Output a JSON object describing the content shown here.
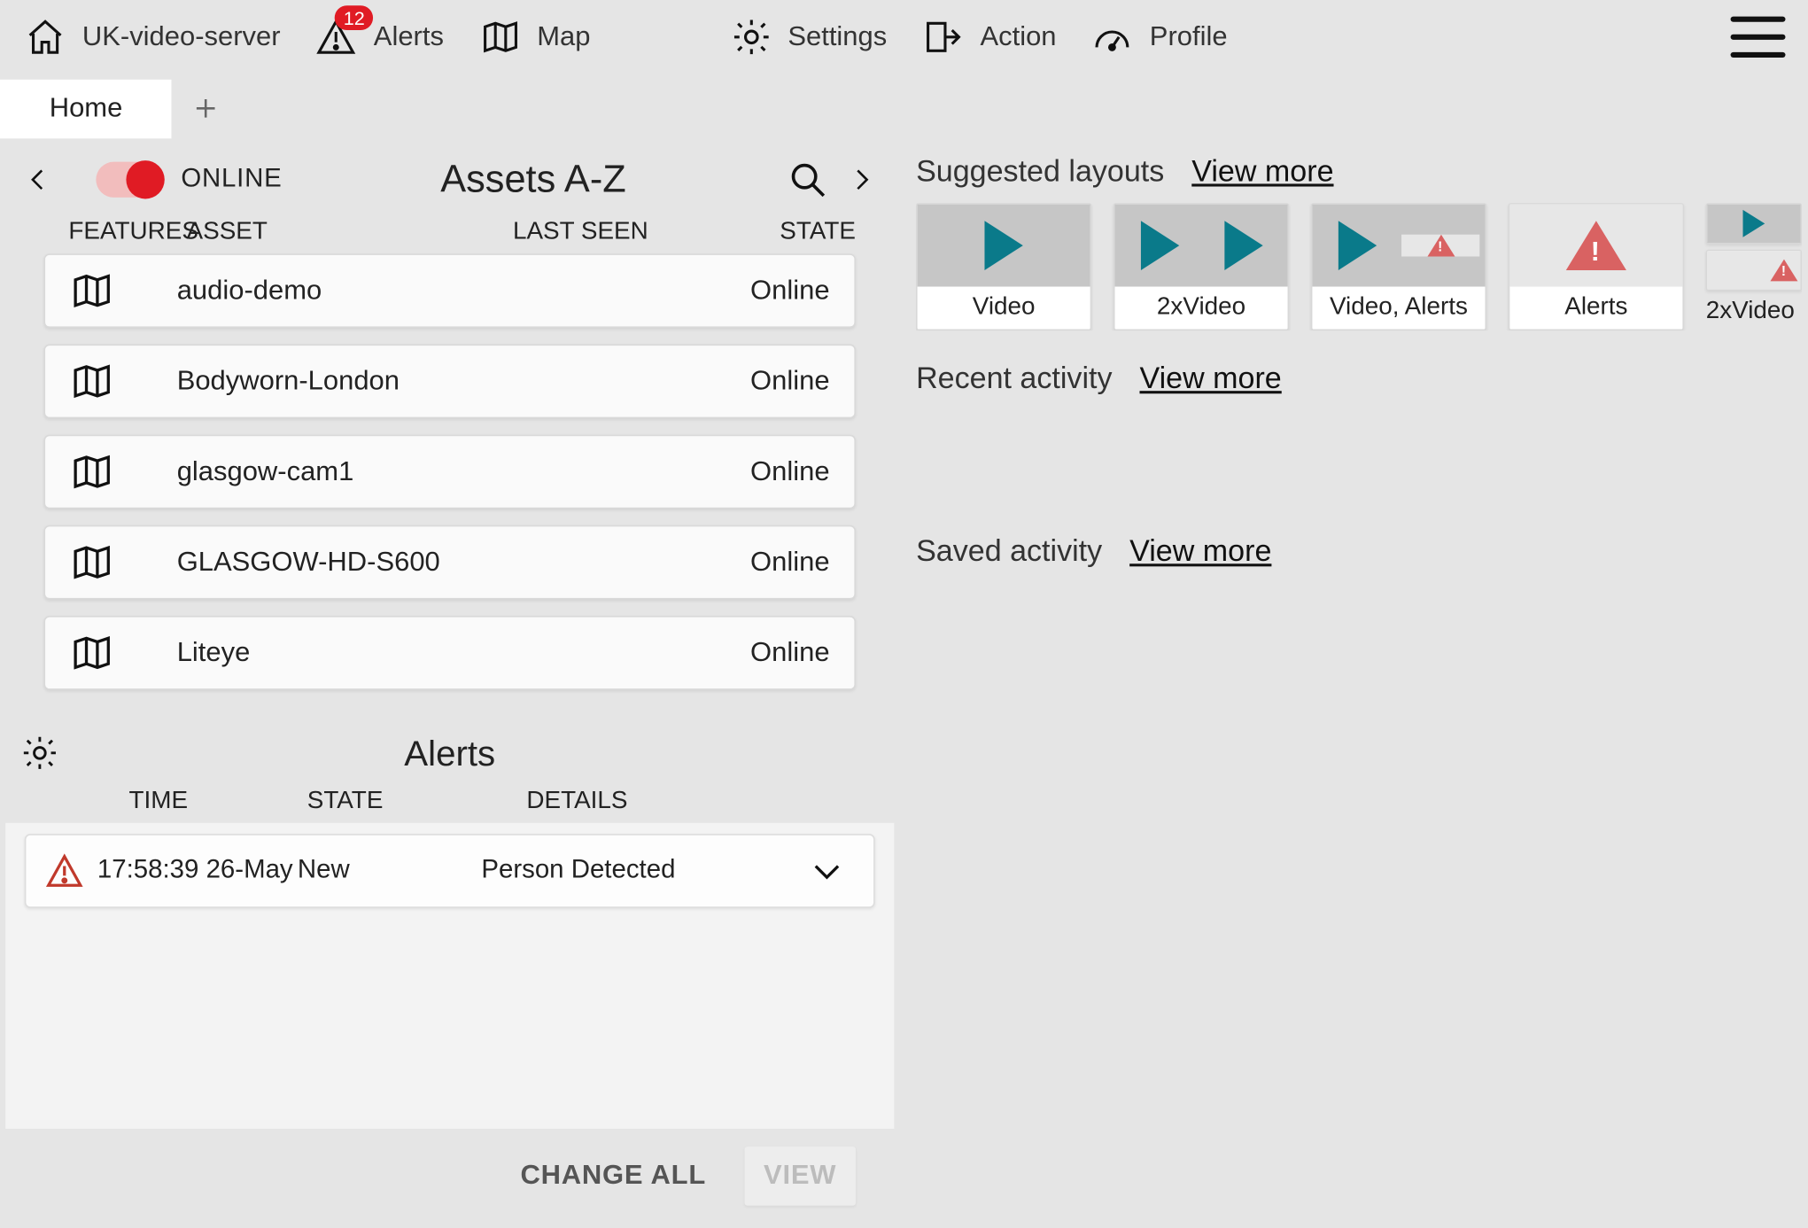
{
  "topbar": {
    "server_label": "UK-video-server",
    "alerts_label": "Alerts",
    "alerts_badge": "12",
    "map_label": "Map",
    "settings_label": "Settings",
    "action_label": "Action",
    "profile_label": "Profile"
  },
  "tabs": {
    "home": "Home"
  },
  "assets": {
    "online_label": "ONLINE",
    "title": "Assets A-Z",
    "cols": {
      "features": "FEATURES",
      "asset": "ASSET",
      "lastseen": "LAST SEEN",
      "state": "STATE"
    },
    "rows": [
      {
        "name": "audio-demo",
        "state": "Online"
      },
      {
        "name": "Bodyworn-London",
        "state": "Online"
      },
      {
        "name": "glasgow-cam1",
        "state": "Online"
      },
      {
        "name": "GLASGOW-HD-S600",
        "state": "Online"
      },
      {
        "name": "Liteye",
        "state": "Online"
      }
    ]
  },
  "alerts": {
    "title": "Alerts",
    "cols": {
      "time": "TIME",
      "state": "STATE",
      "details": "DETAILS"
    },
    "rows": [
      {
        "time": "17:58:39 26-May",
        "state": "New",
        "details": "Person Detected"
      }
    ],
    "change_all": "CHANGE ALL",
    "view": "VIEW"
  },
  "right": {
    "suggested_title": "Suggested layouts",
    "view_more": "View more",
    "layouts": [
      {
        "label": "Video"
      },
      {
        "label": "2xVideo"
      },
      {
        "label": "Video, Alerts"
      },
      {
        "label": "Alerts"
      },
      {
        "label": "2xVideo"
      }
    ],
    "recent_title": "Recent activity",
    "saved_title": "Saved activity"
  }
}
